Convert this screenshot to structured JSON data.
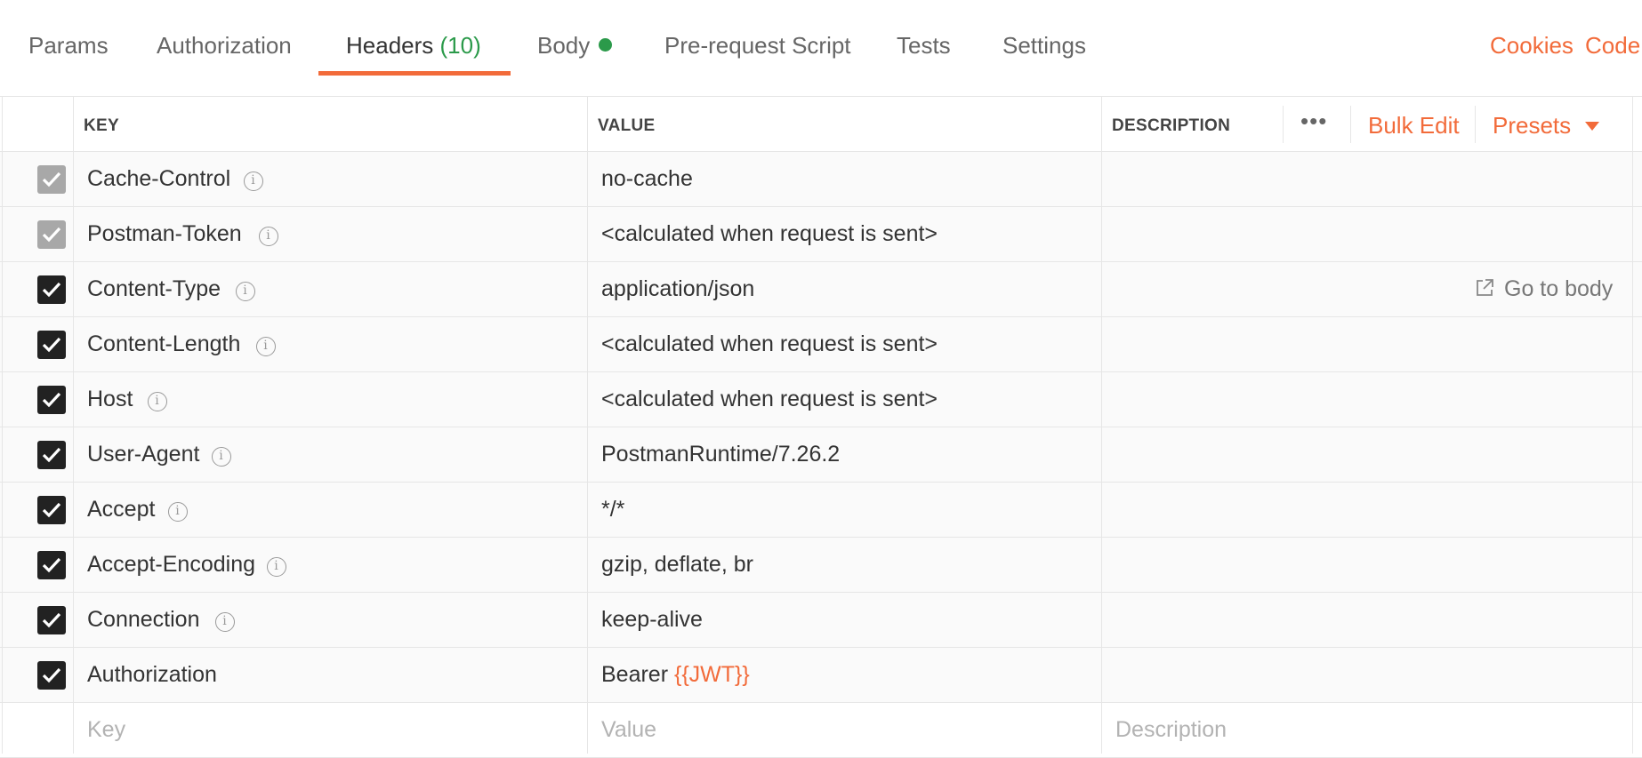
{
  "tabs": [
    {
      "label": "Params"
    },
    {
      "label": "Authorization"
    },
    {
      "label": "Headers",
      "count": "(10)"
    },
    {
      "label": "Body"
    },
    {
      "label": "Pre-request Script"
    },
    {
      "label": "Tests"
    },
    {
      "label": "Settings"
    }
  ],
  "active_tab": "Headers",
  "right_links": {
    "cookies": "Cookies",
    "code": "Code"
  },
  "table": {
    "headers": {
      "key": "KEY",
      "value": "VALUE",
      "description": "DESCRIPTION"
    },
    "more_label": "•••",
    "bulk_edit": "Bulk Edit",
    "presets": "Presets",
    "rows": [
      {
        "key": "Cache-Control",
        "value": "no-cache"
      },
      {
        "key": "Postman-Token",
        "value": "<calculated when request is sent>"
      },
      {
        "key": "Content-Type",
        "value": "application/json",
        "action": "Go to body"
      },
      {
        "key": "Content-Length",
        "value": "<calculated when request is sent>"
      },
      {
        "key": "Host",
        "value": "<calculated when request is sent>"
      },
      {
        "key": "User-Agent",
        "value": "PostmanRuntime/7.26.2"
      },
      {
        "key": "Accept",
        "value": "*/*"
      },
      {
        "key": "Accept-Encoding",
        "value": "gzip, deflate, br"
      },
      {
        "key": "Connection",
        "value": "keep-alive"
      },
      {
        "key": "Authorization",
        "value_prefix": "Bearer ",
        "value_var": "{{JWT}}"
      }
    ],
    "placeholders": {
      "key": "Key",
      "value": "Value",
      "description": "Description"
    }
  },
  "colors": {
    "accent": "#f26b3a",
    "success": "#2b9a4a",
    "checkbox": "#222222",
    "checkbox_disabled": "#a8a8a8"
  },
  "icons": {
    "info": "info-circle-icon",
    "check": "check-icon",
    "external": "external-link-icon",
    "caret": "caret-down-icon",
    "more": "more-horizontal-icon"
  }
}
